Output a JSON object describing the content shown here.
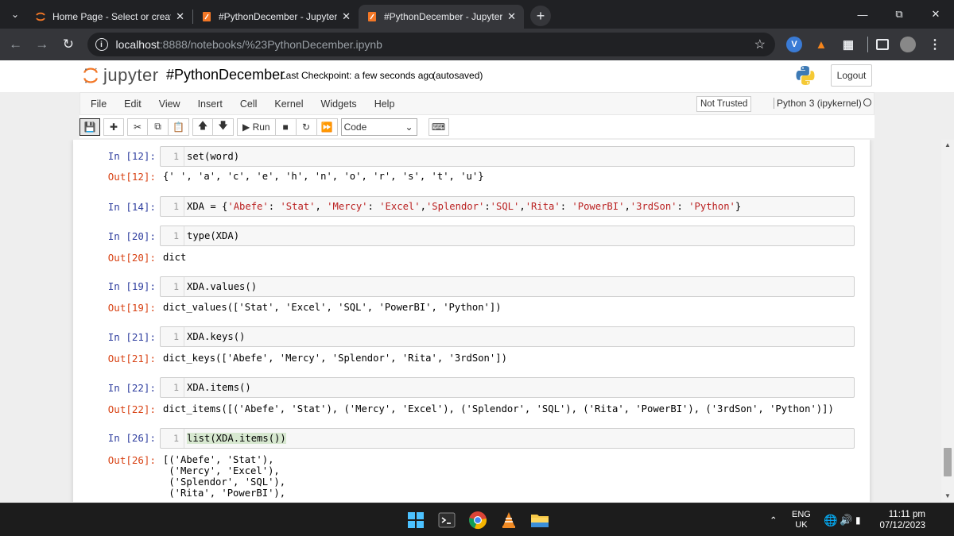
{
  "browser": {
    "tabs": [
      {
        "title": "Home Page - Select or create a notebook",
        "active": false
      },
      {
        "title": "#PythonDecember - Jupyter Notebook",
        "active": false
      },
      {
        "title": "#PythonDecember - Jupyter Notebook",
        "active": true
      }
    ],
    "url_host": "localhost",
    "url_path": ":8888/notebooks/%23PythonDecember.ipynb"
  },
  "jupyter": {
    "logo_text": "jupyter",
    "notebook_name": "#PythonDecember",
    "checkpoint": "Last Checkpoint: a few seconds ago",
    "autosave": "(autosaved)",
    "logout_label": "Logout",
    "menu": [
      "File",
      "Edit",
      "View",
      "Insert",
      "Cell",
      "Kernel",
      "Widgets",
      "Help"
    ],
    "trust_label": "Not Trusted",
    "kernel_label": "Python 3 (ipykernel)",
    "run_label": "Run",
    "cell_type": "Code"
  },
  "cells": [
    {
      "in_prompt": "In [12]:",
      "line": "1",
      "code": "set(word)",
      "out_prompt": "Out[12]:",
      "output": "{' ', 'a', 'c', 'e', 'h', 'n', 'o', 'r', 's', 't', 'u'}"
    },
    {
      "in_prompt": "In [14]:",
      "line": "1",
      "code": "XDA = {'Abefe': 'Stat', 'Mercy': 'Excel','Splendor':'SQL','Rita': 'PowerBI','3rdSon': 'Python'}",
      "out_prompt": "",
      "output": ""
    },
    {
      "in_prompt": "In [20]:",
      "line": "1",
      "code": "type(XDA)",
      "out_prompt": "Out[20]:",
      "output": "dict"
    },
    {
      "in_prompt": "In [19]:",
      "line": "1",
      "code": "XDA.values()",
      "out_prompt": "Out[19]:",
      "output": "dict_values(['Stat', 'Excel', 'SQL', 'PowerBI', 'Python'])"
    },
    {
      "in_prompt": "In [21]:",
      "line": "1",
      "code": "XDA.keys()",
      "out_prompt": "Out[21]:",
      "output": "dict_keys(['Abefe', 'Mercy', 'Splendor', 'Rita', '3rdSon'])"
    },
    {
      "in_prompt": "In [22]:",
      "line": "1",
      "code": "XDA.items()",
      "out_prompt": "Out[22]:",
      "output": "dict_items([('Abefe', 'Stat'), ('Mercy', 'Excel'), ('Splendor', 'SQL'), ('Rita', 'PowerBI'), ('3rdSon', 'Python')])"
    },
    {
      "in_prompt": "In [26]:",
      "line": "1",
      "code": "list(XDA.items())",
      "out_prompt": "Out[26]:",
      "output": "[('Abefe', 'Stat'),\n ('Mercy', 'Excel'),\n ('Splendor', 'SQL'),\n ('Rita', 'PowerBI'),"
    }
  ],
  "taskbar": {
    "language": "ENG",
    "region": "UK",
    "time": "11:11 pm",
    "date": "07/12/2023"
  }
}
